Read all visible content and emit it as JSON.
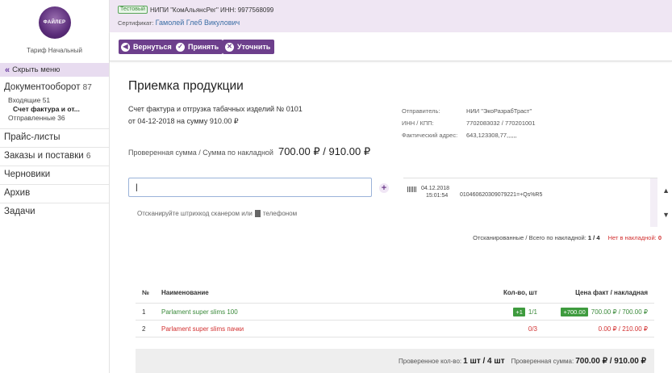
{
  "sidebar": {
    "logo_text": "ФАЙЛЕР",
    "tariff": "Тариф Начальный",
    "hide_menu": "Скрыть меню",
    "items": [
      {
        "label": "Документооборот",
        "count": "87"
      },
      {
        "label": "Прайс-листы",
        "count": ""
      },
      {
        "label": "Заказы и поставки",
        "count": "6"
      },
      {
        "label": "Черновики",
        "count": ""
      },
      {
        "label": "Архив",
        "count": ""
      },
      {
        "label": "Задачи",
        "count": ""
      }
    ],
    "sub": {
      "incoming": "Входящие",
      "incoming_count": "51",
      "current": "Счет фактура и от...",
      "sent": "Отправленные",
      "sent_count": "36"
    }
  },
  "header": {
    "test_badge": "Тестовый",
    "org": "НИПИ \"КомАльянсРег\" ИНН: 9977568099",
    "cert_label": "Сертификат:",
    "cert_name": "Гамолей Глеб Викулович"
  },
  "toolbar": {
    "back": "Вернуться",
    "accept": "Принять",
    "clarify": "Уточнить"
  },
  "main": {
    "title": "Приемка продукции",
    "invoice_line1": "Счет фактура и отгрузка табачных изделий № 0101",
    "invoice_line2": "от 04-12-2018 на сумму 910.00 ₽",
    "checked_label": "Проверенная сумма / Сумма по накладной",
    "checked_value": "700.00 ₽  / 910.00 ₽",
    "sender": {
      "sender_label": "Отправитель:",
      "sender_value": "НИИ \"ЭкоРазрабТраст\"",
      "inn_label": "ИНН / КПП:",
      "inn_value": "7702083032 / 770201001",
      "addr_label": "Фактический адрес:",
      "addr_value": "643,123308,77,,,,,,"
    },
    "scan_value": "|",
    "scan_hint_pre": "Отсканируйте штрихкод сканером или",
    "scan_hint_post": "телефоном",
    "scan_entry": {
      "date": "04.12.2018",
      "time": "15:01:54",
      "code": "010460620309079221=+Qs%R5"
    },
    "scanned_label": "Отсканированные / Всего по накладной:",
    "scanned_value": "1 / 4",
    "missing_label": "Нет в накладной:",
    "missing_value": "0"
  },
  "table": {
    "headers": {
      "n": "№",
      "name": "Наименование",
      "qty": "Кол-во, шт",
      "price": "Цена факт / накладная"
    },
    "rows": [
      {
        "n": "1",
        "name": "Parlament super slims 100",
        "qty_badge": "+1",
        "qty": "1/1",
        "price_badge": "+700.00",
        "price": "700.00 ₽ / 700.00 ₽"
      },
      {
        "n": "2",
        "name": "Parlament super slims пачки",
        "qty": "0/3",
        "price": "0.00 ₽ / 210.00 ₽"
      }
    ],
    "footer_qty_label": "Проверенное кол-во:",
    "footer_qty": "1 шт / 4 шт",
    "footer_sum_label": "Проверенная сумма:",
    "footer_sum": "700.00 ₽ / 910.00 ₽"
  }
}
